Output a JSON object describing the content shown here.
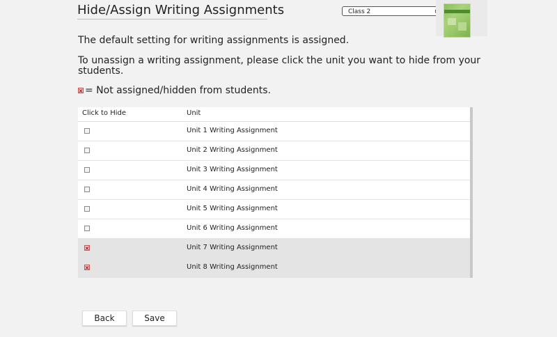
{
  "page": {
    "title": "Hide/Assign Writing Assignments",
    "class_select": {
      "selected": "Class 2",
      "icon": "up-down-arrows-icon"
    },
    "thumbnail": {
      "icon": "book-cover-thumbnail"
    },
    "paragraph_default": "The default setting for writing assignments is assigned.",
    "paragraph_instructions": "To unassign a writing assignment, please click the unit you want to hide from your students.",
    "legend_text": "= Not assigned/hidden from students."
  },
  "table": {
    "headers": {
      "click_to_hide": "Click to Hide",
      "unit": "Unit"
    },
    "rows": [
      {
        "unit": "Unit 1 Writing Assignment",
        "hidden": false
      },
      {
        "unit": "Unit 2 Writing Assignment",
        "hidden": false
      },
      {
        "unit": "Unit 3 Writing Assignment",
        "hidden": false
      },
      {
        "unit": "Unit 4 Writing Assignment",
        "hidden": false
      },
      {
        "unit": "Unit 5 Writing Assignment",
        "hidden": false
      },
      {
        "unit": "Unit 6 Writing Assignment",
        "hidden": false
      },
      {
        "unit": "Unit 7 Writing Assignment",
        "hidden": true
      },
      {
        "unit": "Unit 8 Writing Assignment",
        "hidden": true
      }
    ]
  },
  "buttons": {
    "back": "Back",
    "save": "Save"
  },
  "colors": {
    "background": "#f2f2f2",
    "hidden_row": "#e4e4e4",
    "hidden_marker": "#cc0000"
  }
}
